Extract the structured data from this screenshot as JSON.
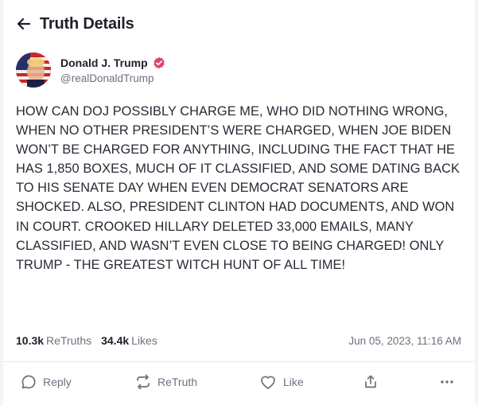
{
  "header": {
    "title": "Truth Details",
    "back_icon": "arrow-left-icon"
  },
  "author": {
    "display_name": "Donald J. Trump",
    "handle": "@realDonaldTrump",
    "verified": true,
    "verified_color": "#e3446a"
  },
  "post": {
    "text": "HOW CAN DOJ POSSIBLY CHARGE ME, WHO DID NOTHING WRONG, WHEN NO OTHER PRESIDENT’S WERE CHARGED, WHEN JOE BIDEN WON’T BE CHARGED FOR ANYTHING, INCLUDING THE FACT THAT HE HAS 1,850 BOXES, MUCH OF IT CLASSIFIED, AND SOME DATING BACK TO HIS SENATE DAY WHEN EVEN DEMOCRAT SENATORS ARE SHOCKED. ALSO, PRESIDENT CLINTON HAD DOCUMENTS, AND WON IN COURT. CROOKED HILLARY DELETED 33,000 EMAILS, MANY CLASSIFIED, AND WASN’T EVEN CLOSE TO BEING CHARGED! ONLY TRUMP - THE GREATEST WITCH HUNT OF ALL TIME!"
  },
  "stats": {
    "retruths_count": "10.3k",
    "retruths_label": "ReTruths",
    "likes_count": "34.4k",
    "likes_label": "Likes",
    "timestamp": "Jun 05, 2023, 11:16 AM"
  },
  "actions": {
    "reply_label": "Reply",
    "reply_icon": "comment-bubble-icon",
    "retruth_label": "ReTruth",
    "retruth_icon": "repost-icon",
    "like_label": "Like",
    "like_icon": "heart-icon",
    "share_icon": "share-icon",
    "more_icon": "more-horizontal-icon"
  },
  "colors": {
    "text": "#1f1f2b",
    "muted": "#6f6f80",
    "background": "#f4f4f6",
    "card": "#ffffff"
  }
}
